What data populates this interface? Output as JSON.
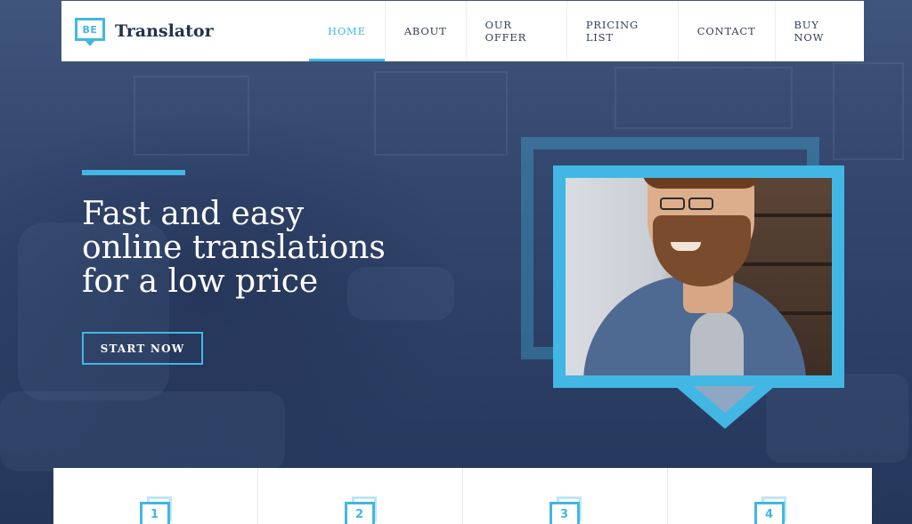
{
  "brand": {
    "badge": "BE",
    "name": "Translator"
  },
  "nav": {
    "items": [
      {
        "label": "HOME",
        "active": true
      },
      {
        "label": "ABOUT",
        "active": false
      },
      {
        "label": "OUR OFFER",
        "active": false
      },
      {
        "label": "PRICING LIST",
        "active": false
      },
      {
        "label": "CONTACT",
        "active": false
      },
      {
        "label": "BUY NOW",
        "active": false
      }
    ]
  },
  "hero": {
    "headline_lines": [
      "Fast and easy",
      "online translations",
      "for a low price"
    ],
    "cta_label": "START NOW"
  },
  "steps": [
    {
      "number": "1"
    },
    {
      "number": "2"
    },
    {
      "number": "3"
    },
    {
      "number": "4"
    }
  ],
  "colors": {
    "accent": "#42b7e3",
    "hero_bg": "#33466d",
    "nav_text": "#2f3e5c",
    "white": "#ffffff"
  }
}
